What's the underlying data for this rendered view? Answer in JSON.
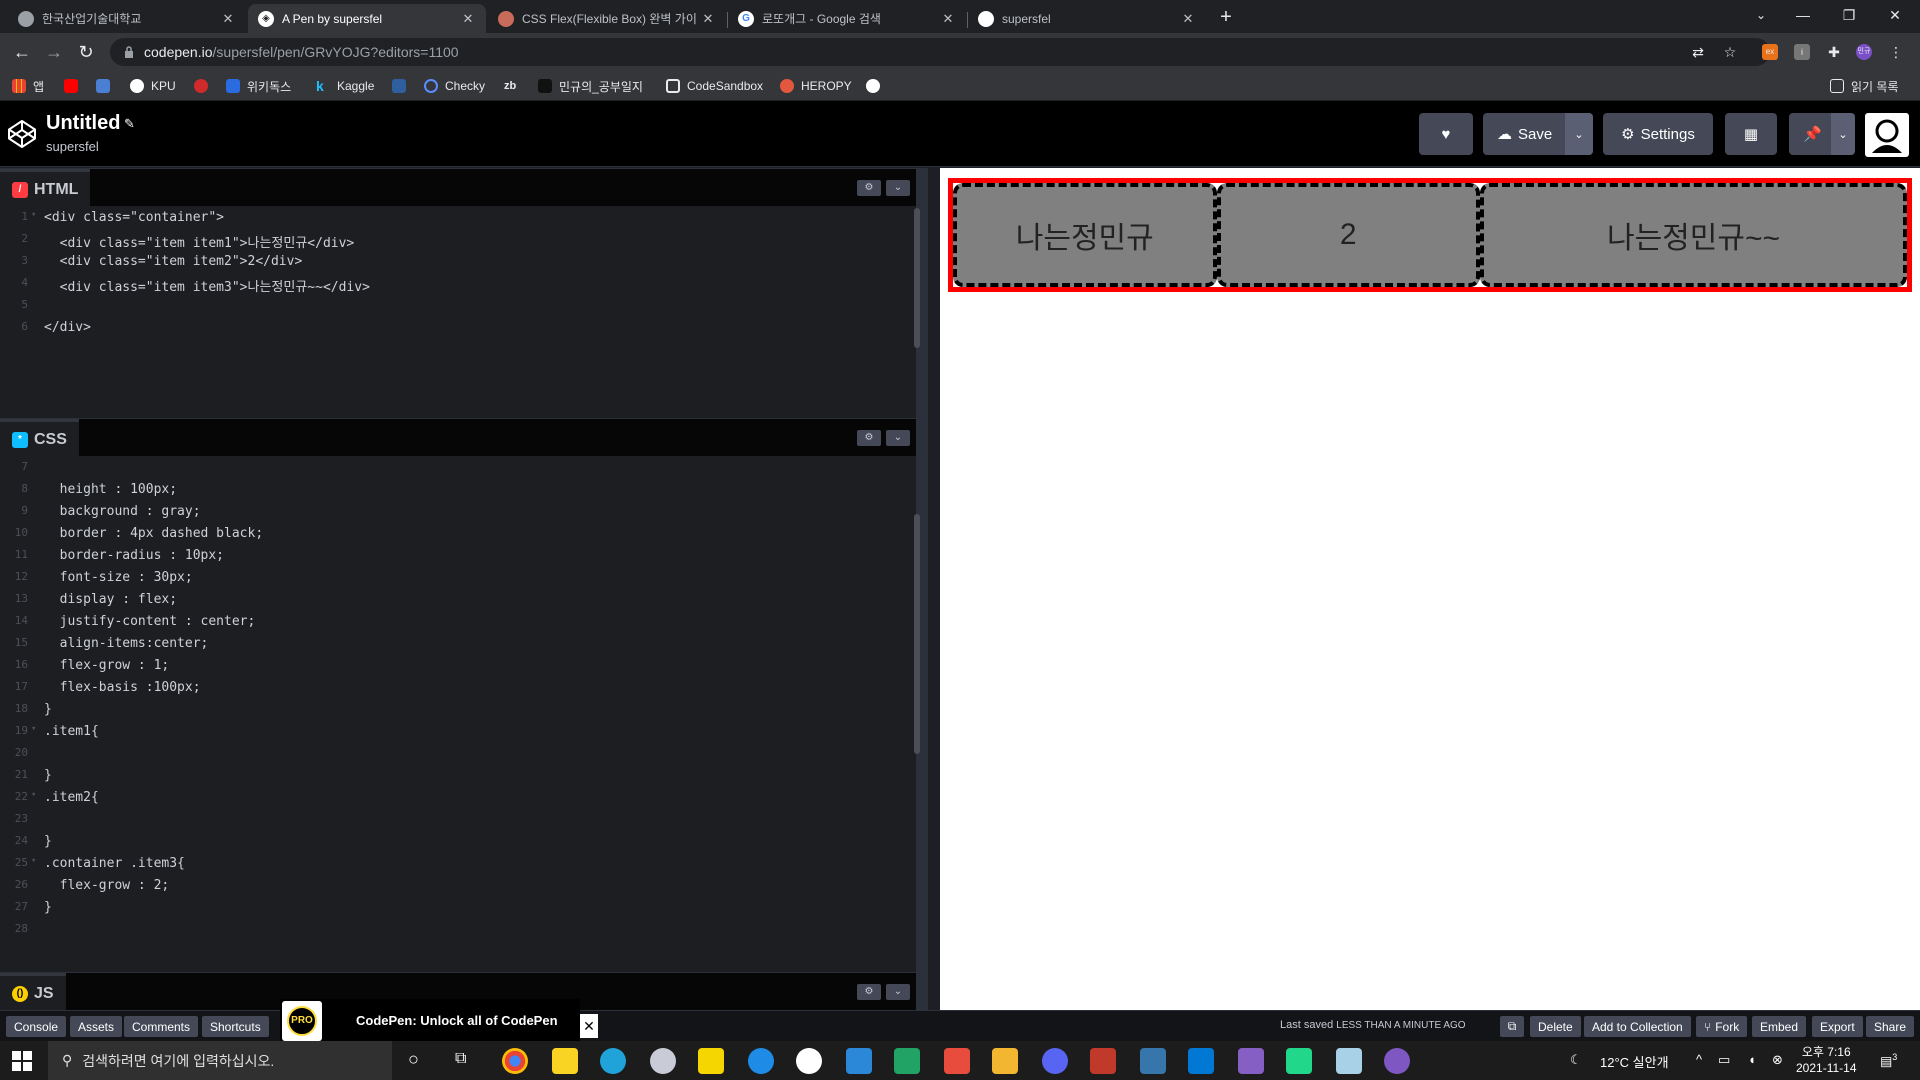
{
  "browser": {
    "tabs": [
      {
        "title": "한국산업기술대학교",
        "active": false
      },
      {
        "title": "A Pen by supersfel",
        "active": true
      },
      {
        "title": "CSS Flex(Flexible Box) 완벽 가이",
        "active": false
      },
      {
        "title": "로또개그 - Google 검색",
        "active": false
      },
      {
        "title": "supersfel",
        "active": false
      }
    ],
    "url_host": "codepen.io",
    "url_path": "/supersfel/pen/GRvYOJG?editors=1100",
    "bookmarks": [
      "앱",
      "KPU",
      "위키독스",
      "Kaggle",
      "Checky",
      "zb",
      "민규의_공부일지",
      "CodeSandbox",
      "HEROPY"
    ],
    "reading_list": "읽기 목록",
    "profile_initials": "민규"
  },
  "codepen": {
    "pen_title": "Untitled",
    "author": "supersfel",
    "save_label": "Save",
    "settings_label": "Settings"
  },
  "editors": {
    "html": {
      "label": "HTML",
      "lines": [
        {
          "n": "1",
          "text": "<div class=\"container\">"
        },
        {
          "n": "2",
          "text": "  <div class=\"item item1\">나는정민규</div>"
        },
        {
          "n": "3",
          "text": "  <div class=\"item item2\">2</div>"
        },
        {
          "n": "4",
          "text": "  <div class=\"item item3\">나는정민규~~</div>"
        },
        {
          "n": "5",
          "text": ""
        },
        {
          "n": "6",
          "text": "</div>"
        }
      ]
    },
    "css": {
      "label": "CSS",
      "lines": [
        {
          "n": "7",
          "text": ""
        },
        {
          "n": "8",
          "text": "  height : 100px;"
        },
        {
          "n": "9",
          "text": "  background : gray;"
        },
        {
          "n": "10",
          "text": "  border : 4px dashed black;"
        },
        {
          "n": "11",
          "text": "  border-radius : 10px;"
        },
        {
          "n": "12",
          "text": "  font-size : 30px;"
        },
        {
          "n": "13",
          "text": "  display : flex;"
        },
        {
          "n": "14",
          "text": "  justify-content : center;"
        },
        {
          "n": "15",
          "text": "  align-items:center;"
        },
        {
          "n": "16",
          "text": "  flex-grow : 1;"
        },
        {
          "n": "17",
          "text": "  flex-basis :100px;"
        },
        {
          "n": "18",
          "text": "}"
        },
        {
          "n": "19",
          "text": ".item1{"
        },
        {
          "n": "20",
          "text": ""
        },
        {
          "n": "21",
          "text": "}"
        },
        {
          "n": "22",
          "text": ".item2{"
        },
        {
          "n": "23",
          "text": ""
        },
        {
          "n": "24",
          "text": "}"
        },
        {
          "n": "25",
          "text": ".container .item3{"
        },
        {
          "n": "26",
          "text": "  flex-grow : 2;"
        },
        {
          "n": "27",
          "text": "}"
        },
        {
          "n": "28",
          "text": ""
        }
      ]
    },
    "js": {
      "label": "JS"
    }
  },
  "preview": {
    "items": [
      {
        "text": "나는정민규",
        "grow": 1
      },
      {
        "text": "2",
        "grow": 1
      },
      {
        "text": "나는정민규~~",
        "grow": 2
      }
    ]
  },
  "footer": {
    "left_buttons": [
      "Console",
      "Assets",
      "Comments",
      "Shortcuts"
    ],
    "promo_text": "CodePen: Unlock all of CodePen",
    "promo_badge": "PRO",
    "last_saved_prefix": "Last saved",
    "last_saved_value": "LESS THAN A MINUTE AGO",
    "right_buttons": [
      "Delete",
      "Add to Collection",
      "Fork",
      "Embed",
      "Export",
      "Share"
    ]
  },
  "taskbar": {
    "search_placeholder": "검색하려면 여기에 입력하십시오.",
    "weather": "12°C  실안개",
    "time": "오후 7:16",
    "date": "2021-11-14",
    "notification_count": "3"
  },
  "colors": {
    "codepen_bg": "#1d1e22",
    "html_badge": "#ff3c41",
    "css_badge": "#0ebeff",
    "js_badge": "#fcd000",
    "container_border": "#ff0000"
  }
}
